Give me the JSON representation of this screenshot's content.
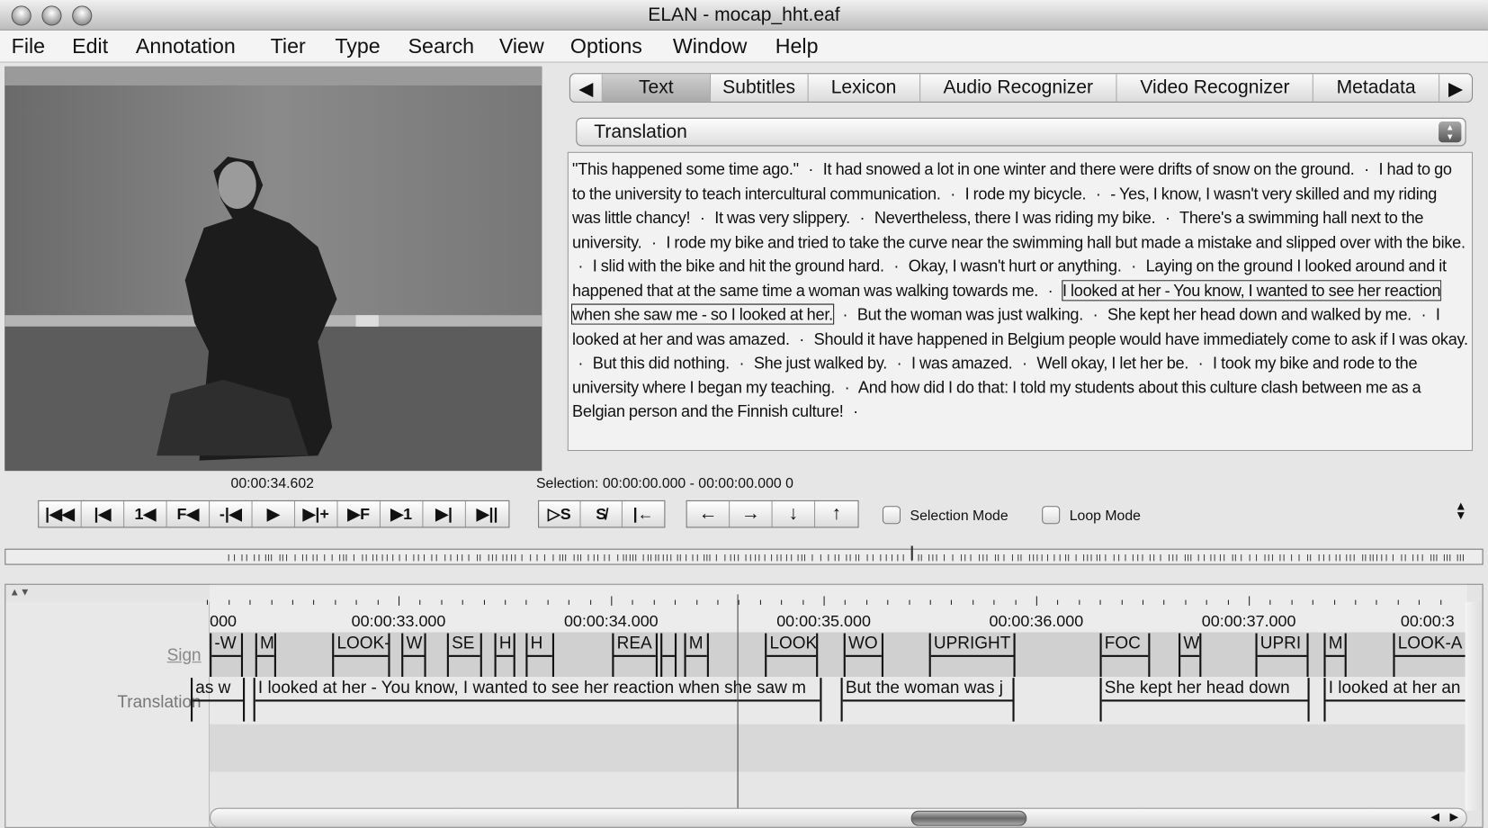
{
  "window": {
    "title": "ELAN - mocap_hht.eaf"
  },
  "menu": [
    "File",
    "Edit",
    "Annotation",
    "Tier",
    "Type",
    "Search",
    "View",
    "Options",
    "Window",
    "Help"
  ],
  "tabs": {
    "prev": "◀",
    "next": "▶",
    "items": [
      "Text",
      "Subtitles",
      "Lexicon",
      "Audio Recognizer",
      "Video Recognizer",
      "Metadata"
    ],
    "selected": "Text"
  },
  "tier_select": {
    "value": "Translation"
  },
  "text_view": {
    "separator": "·",
    "highlighted_index": 12,
    "segments": [
      "\"This happened some time ago.\"",
      "It had snowed a lot in one winter and there were drifts of snow on the ground.",
      "I had to go to the university to teach intercultural communication.",
      "I rode my bicycle.",
      "- Yes, I know, I wasn't very skilled and my riding was little chancy!",
      "It was very slippery.",
      "Nevertheless, there I was riding my bike.",
      "There's a swimming hall next to the university.",
      "I rode my bike and tried to take the curve near the swimming hall but made a mistake and slipped over with the bike.",
      "I slid with the bike and hit the ground hard.",
      "Okay, I wasn't hurt or anything.",
      "Laying on the ground I looked around and it happened that at the same time a woman was walking towards me.",
      "I looked at her - You know, I wanted to see her reaction when she saw me - so I looked at her.",
      "But the woman was just walking.",
      "She kept her head down and walked by me.",
      "I looked at her and was amazed.",
      "Should it have happened in Belgium people would have immediately come to ask if I was okay.",
      "But this did nothing.",
      "She just walked by.",
      "I was amazed.",
      "Well okay, I let her be.",
      "I took my bike and rode to the university where I began my teaching.",
      "And how did I do that: I told my students about this culture clash between me as a Belgian person and the Finnish culture!"
    ]
  },
  "player": {
    "current_time": "00:00:34.602",
    "selection": "Selection: 00:00:00.000 - 00:00:00.000  0",
    "nav_buttons": [
      "|◀◀",
      "|◀",
      "1◀",
      "F◀",
      "-|◀",
      "▶",
      "▶|+",
      "▶F",
      "▶1",
      "▶|",
      "▶||"
    ],
    "selection_buttons": [
      "▷S",
      "S̸",
      "|←"
    ],
    "arrow_buttons": [
      "←",
      "→",
      "↓",
      "↑"
    ],
    "selection_mode": {
      "label": "Selection Mode",
      "checked": false
    },
    "loop_mode": {
      "label": "Loop Mode",
      "checked": false
    }
  },
  "timeline": {
    "ruler_labels": [
      "000",
      "00:00:33.000",
      "00:00:34.000",
      "00:00:35.000",
      "00:00:36.000",
      "00:00:37.000",
      "00:00:3"
    ],
    "tiers": [
      {
        "name": "Sign",
        "annotations": [
          "-W",
          "M",
          "LOOK-",
          "W",
          "SE",
          "H",
          "H",
          "REA",
          "",
          "M",
          "LOOK",
          "WO",
          "UPRIGHT",
          "FOC",
          "W",
          "UPRI",
          "M",
          "LOOK-A"
        ]
      },
      {
        "name": "Translation",
        "annotations": [
          "as w",
          "I looked at her - You know, I wanted to see her reaction when she saw m",
          "But the woman was j",
          "She kept her head down",
          "I looked at her an"
        ]
      }
    ]
  }
}
